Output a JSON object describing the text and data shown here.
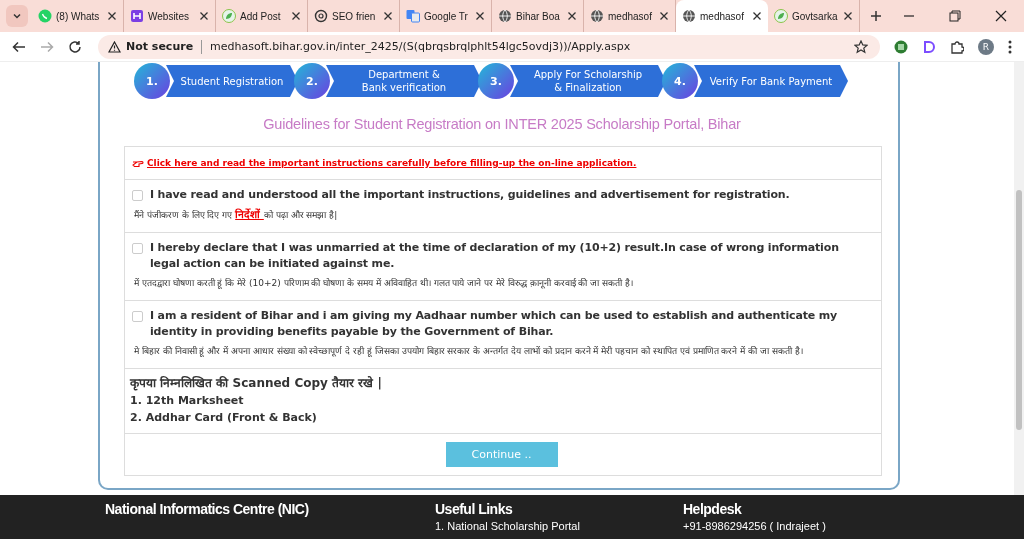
{
  "browser": {
    "tabs": [
      {
        "title": "(8) Whats",
        "kind": "chat",
        "selected": false
      },
      {
        "title": "Websites",
        "kind": "grid",
        "selected": false
      },
      {
        "title": "Add Post",
        "kind": "leaf",
        "selected": false
      },
      {
        "title": "SEO frien",
        "kind": "flower",
        "selected": false
      },
      {
        "title": "Google Tr",
        "kind": "translate",
        "selected": false
      },
      {
        "title": "Bihar Boa",
        "kind": "globe",
        "selected": false
      },
      {
        "title": "medhasof",
        "kind": "globe",
        "selected": false
      },
      {
        "title": "medhasof",
        "kind": "globe",
        "selected": true
      },
      {
        "title": "Govtsarka",
        "kind": "leaf",
        "selected": false
      }
    ],
    "security": "Not secure",
    "url": "medhasoft.bihar.gov.in/inter_2425/(S(qbrqsbrqlphlt54lgc5ovdj3))/Apply.aspx",
    "profile": "R"
  },
  "steps": [
    {
      "number": "1.",
      "label": "Student Registration"
    },
    {
      "number": "2.",
      "label": "Department &\nBank verification"
    },
    {
      "number": "3.",
      "label": "Apply For Scholarship\n& Finalization"
    },
    {
      "number": "4.",
      "label": "Verify For Bank Payment"
    }
  ],
  "heading": "Guidelines for Student Registration on INTER 2025 Scholarship Portal, Bihar",
  "instructions_link": "Click here and read the important instructions carefully before filling-up the on-line application.",
  "declarations": [
    {
      "text": "I have read and understood all the important instructions, guidelines and advertisement for registration.",
      "hindi_before": "मैंने पंजीकरण के लिए दिए गए ",
      "hindi_link": "निर्देशों ",
      "hindi_after": "को पढ़ा और समझा है|",
      "checked": false
    },
    {
      "text": "I hereby declare that I was unmarried at the time of declaration of my (10+2) result.In case of wrong information legal action can be initiated against me.",
      "hindi_before": "में एतदद्वारा घोषणा करती हूं कि मेरे (10+2) परिणाम की घोषणा के समय में अविवाहित थी। गलत पाये जाने पर मेरे विरुद्ध क़ानूनी करवाई की जा सकती है।",
      "checked": false
    },
    {
      "text": "I am a resident of Bihar and i am giving my Aadhaar number which can be used to establish and authenticate my identity in providing benefits payable by the Government of Bihar.",
      "hindi_before": "मे बिहार की निवासी हूं और में अपना आधार संख्या को स्वेच्छापूर्ण दे रही हूं जिसका उपयोग बिहार सरकार के अन्तर्गत देय लाभों को प्रदान करने में मेरी पहचान को स्थापित एवं प्रमाणित करने में की जा सकती है।",
      "checked": false
    }
  ],
  "documents": {
    "title": "कृपया निम्नलिखित की Scanned Copy तैयार रखे |",
    "items": [
      "1. 12th Marksheet",
      "2. Addhar Card (Front & Back)"
    ]
  },
  "continue_button": "Continue ..",
  "footer": [
    {
      "heading": "National Informatics Centre (NIC)"
    },
    {
      "heading": "Useful Links",
      "line": "1. National Scholarship Portal"
    },
    {
      "heading": "Helpdesk",
      "line": "+91-8986294256 ( Indrajeet )"
    }
  ]
}
